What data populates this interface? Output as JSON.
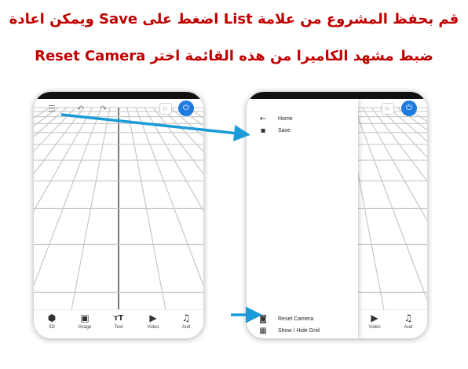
{
  "caption": {
    "line1": "قم بحفظ المشروع من علامة List اضغط على Save ويمكن اعادة",
    "line2": "ضبط مشهد الكاميرا من هذه القائمة اختر Reset Camera"
  },
  "colors": {
    "caption": "#c00000",
    "arrow": "#1a9bd8",
    "power_button": "#1e7be0",
    "grid_line": "#c7c7c7",
    "grid_axis": "#555555"
  },
  "left_phone": {
    "toolbar": {
      "menu_icon": "menu-icon",
      "undo_icon": "undo-icon",
      "redo_icon": "redo-icon",
      "play_icon": "play-icon",
      "power_icon": "power-icon"
    },
    "bottom_bar": [
      {
        "icon": "cube-icon",
        "label": "3D"
      },
      {
        "icon": "image-icon",
        "label": "Image"
      },
      {
        "icon": "text-icon",
        "label": "Text"
      },
      {
        "icon": "video-icon",
        "label": "Video"
      },
      {
        "icon": "music-icon",
        "label": "Aud"
      }
    ]
  },
  "right_phone": {
    "drawer": {
      "top_items": [
        {
          "icon": "back-arrow-icon",
          "label": "Home"
        },
        {
          "icon": "save-icon",
          "label": "Save"
        }
      ],
      "bottom_items": [
        {
          "icon": "camera-icon",
          "label": "Reset Camera"
        },
        {
          "icon": "grid-icon",
          "label": "Show / Hide Grid"
        }
      ]
    },
    "bottom_bar_visible": [
      {
        "icon": "video-icon",
        "label": "Video"
      },
      {
        "icon": "music-icon",
        "label": "Aud"
      }
    ]
  }
}
